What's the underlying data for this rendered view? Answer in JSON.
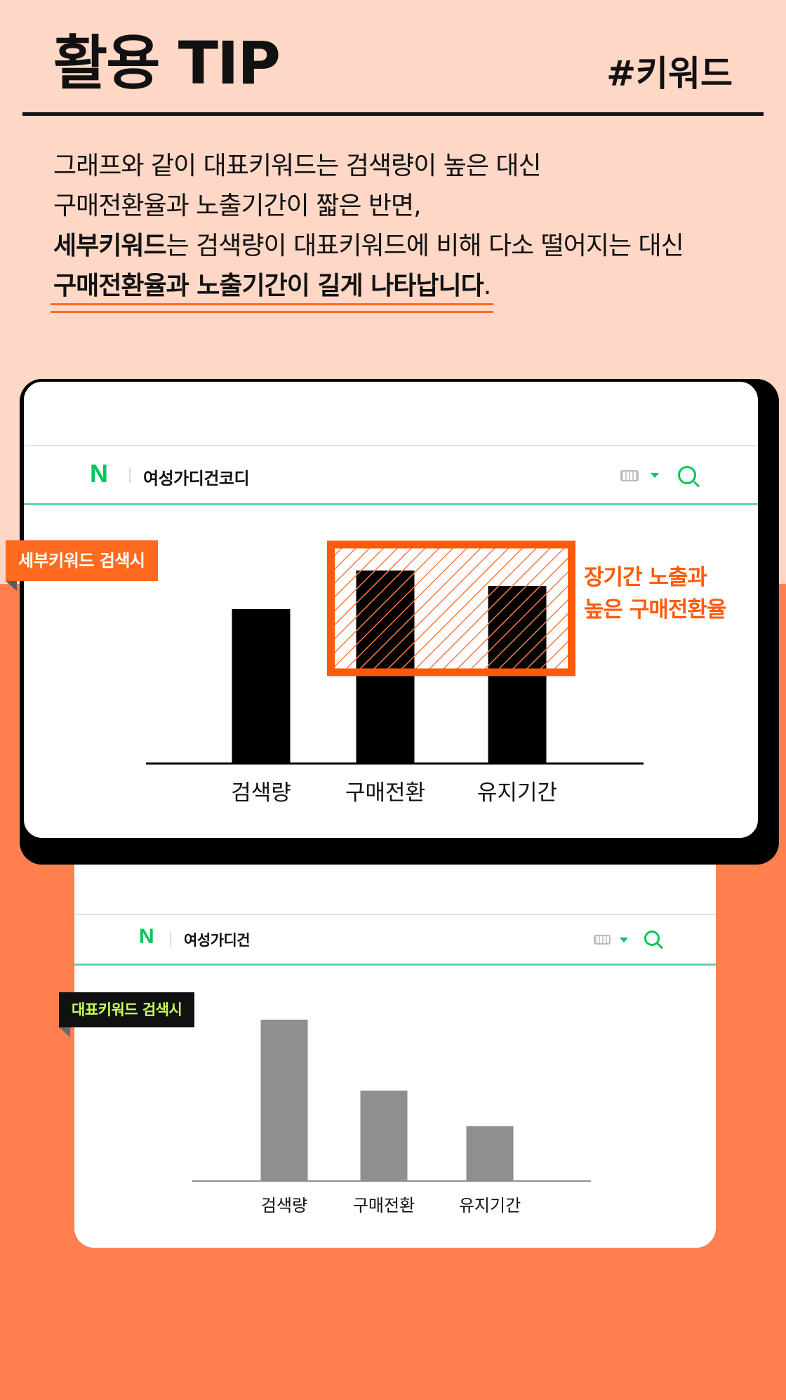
{
  "header": {
    "title": "활용 TIP",
    "tag": "#키워드"
  },
  "intro": {
    "line1": "그래프와 같이 대표키워드는 검색량이 높은 대신",
    "line2": "구매전환율과 노출기간이 짧은 반면,",
    "line3_bold": "세부키워드",
    "line3_rest": "는 검색량이 대표키워드에 비해 다소 떨어지는 대신",
    "line4_bold": "구매전환율과 노출기간이 길게 나타납니다",
    "line4_end": "."
  },
  "detail_card": {
    "logo": "N",
    "query": "여성가디건코디",
    "badge": "세부키워드 검색시",
    "callout_line1": "장기간 노출과",
    "callout_line2": "높은 구매전환율"
  },
  "main_card": {
    "logo": "N",
    "query": "여성가디건",
    "badge": "대표키워드 검색시"
  },
  "colors": {
    "background_top": "#ffd7c6",
    "background_bottom": "#ff7f4f",
    "accent_orange": "#ff6a1f",
    "naver_green": "#03c75a",
    "detail_bars": "#000000",
    "main_bars": "#8f8f8f",
    "badge_text_green": "#c8ff5a"
  },
  "icons": [
    "keyboard-icon",
    "dropdown-caret-icon",
    "search-icon"
  ],
  "chart_data": [
    {
      "type": "bar",
      "name": "세부키워드 검색시",
      "categories": [
        "검색량",
        "구매전환",
        "유지기간"
      ],
      "values": [
        0.8,
        1.0,
        0.92
      ],
      "bar_color": "#000000",
      "highlight_categories": [
        "구매전환",
        "유지기간"
      ],
      "axis": {
        "y_ticks": false,
        "grid": false
      }
    },
    {
      "type": "bar",
      "name": "대표키워드 검색시",
      "categories": [
        "검색량",
        "구매전환",
        "유지기간"
      ],
      "values": [
        1.0,
        0.56,
        0.34
      ],
      "bar_color": "#8f8f8f",
      "axis": {
        "y_ticks": false,
        "grid": false
      }
    }
  ]
}
